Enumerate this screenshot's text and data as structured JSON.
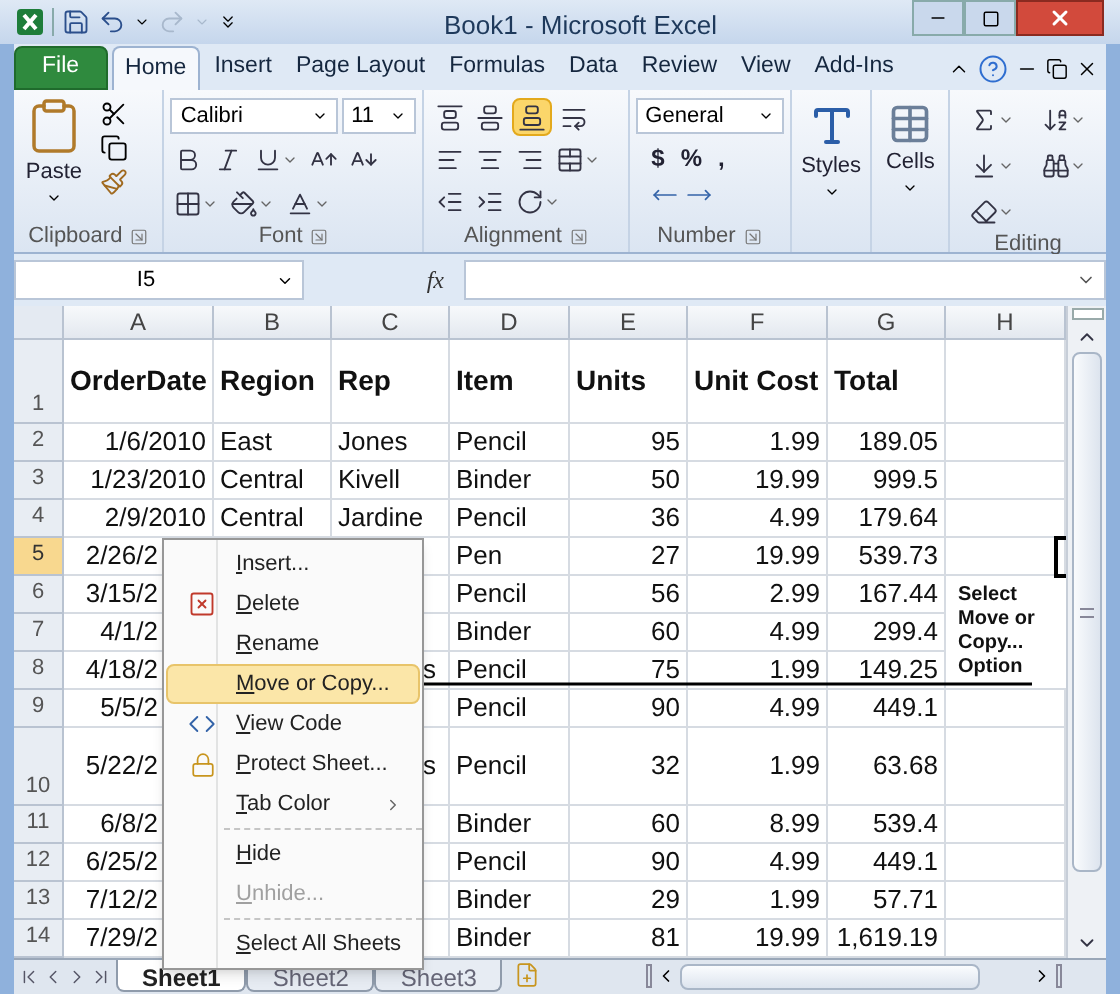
{
  "title_bar": {
    "title": "Book1  -  Microsoft Excel"
  },
  "ribbon_tabs": [
    {
      "label": "File",
      "kind": "file",
      "selected": false
    },
    {
      "label": "Home",
      "kind": "tab",
      "selected": true
    },
    {
      "label": "Insert",
      "kind": "tab",
      "selected": false
    },
    {
      "label": "Page Layout",
      "kind": "tab",
      "selected": false
    },
    {
      "label": "Formulas",
      "kind": "tab",
      "selected": false
    },
    {
      "label": "Data",
      "kind": "tab",
      "selected": false
    },
    {
      "label": "Review",
      "kind": "tab",
      "selected": false
    },
    {
      "label": "View",
      "kind": "tab",
      "selected": false
    },
    {
      "label": "Add-Ins",
      "kind": "tab",
      "selected": false
    }
  ],
  "ribbon": {
    "clipboard": {
      "label": "Clipboard",
      "paste": "Paste"
    },
    "font": {
      "label": "Font",
      "name": "Calibri",
      "size": "11"
    },
    "alignment": {
      "label": "Alignment",
      "vertical": [
        {
          "selected": false
        },
        {
          "selected": false
        },
        {
          "selected": true
        }
      ]
    },
    "number": {
      "label": "Number",
      "format": "General",
      "symbols": [
        "$",
        "%",
        ","
      ]
    },
    "styles": {
      "label": "Styles"
    },
    "cells": {
      "label": "Cells"
    },
    "editing": {
      "label": "Editing"
    }
  },
  "formula_bar": {
    "name_box": "I5",
    "fx": "fx"
  },
  "sheet": {
    "columns": [
      "A",
      "B",
      "C",
      "D",
      "E",
      "F",
      "G",
      "H"
    ],
    "rows": [
      {
        "header": "1",
        "kind": "header",
        "selected": false,
        "cells": [
          "OrderDate",
          "Region",
          "Rep",
          "Item",
          "Units",
          "Unit Cost",
          "Total"
        ]
      },
      {
        "header": "2",
        "kind": "data",
        "selected": false,
        "cells": [
          "1/6/2010",
          "East",
          "Jones",
          "Pencil",
          "95",
          "1.99",
          "189.05"
        ]
      },
      {
        "header": "3",
        "kind": "data",
        "selected": false,
        "cells": [
          "1/23/2010",
          "Central",
          "Kivell",
          "Binder",
          "50",
          "19.99",
          "999.5"
        ]
      },
      {
        "header": "4",
        "kind": "data",
        "selected": false,
        "cells": [
          "2/9/2010",
          "Central",
          "Jardine",
          "Pencil",
          "36",
          "4.99",
          "179.64"
        ]
      },
      {
        "header": "5",
        "kind": "covered",
        "selected": true,
        "cells": [
          "2/26/2",
          null,
          null,
          "Pen",
          "27",
          "19.99",
          "539.73"
        ]
      },
      {
        "header": "6",
        "kind": "covered",
        "selected": false,
        "cells": [
          "3/15/2",
          null,
          null,
          "Pencil",
          "56",
          "2.99",
          "167.44"
        ]
      },
      {
        "header": "7",
        "kind": "covered",
        "selected": false,
        "cells": [
          "4/1/2",
          null,
          null,
          "Binder",
          "60",
          "4.99",
          "299.4"
        ]
      },
      {
        "header": "8",
        "kind": "covered",
        "selected": false,
        "cells": [
          "4/18/2",
          null,
          "s",
          "Pencil",
          "75",
          "1.99",
          "149.25"
        ]
      },
      {
        "header": "9",
        "kind": "covered",
        "selected": false,
        "cells": [
          "5/5/2",
          null,
          null,
          "Pencil",
          "90",
          "4.99",
          "449.1"
        ]
      },
      {
        "header": "10",
        "kind": "covered_tall",
        "selected": false,
        "cells": [
          "5/22/2",
          null,
          "s",
          "Pencil",
          "32",
          "1.99",
          "63.68"
        ]
      },
      {
        "header": "11",
        "kind": "covered",
        "selected": false,
        "cells": [
          "6/8/2",
          null,
          null,
          "Binder",
          "60",
          "8.99",
          "539.4"
        ]
      },
      {
        "header": "12",
        "kind": "covered",
        "selected": false,
        "cells": [
          "6/25/2",
          null,
          null,
          "Pencil",
          "90",
          "4.99",
          "449.1"
        ]
      },
      {
        "header": "13",
        "kind": "covered",
        "selected": false,
        "cells": [
          "7/12/2",
          null,
          null,
          "Binder",
          "29",
          "1.99",
          "57.71"
        ]
      },
      {
        "header": "14",
        "kind": "covered",
        "selected": false,
        "cells": [
          "7/29/2",
          null,
          null,
          "Binder",
          "81",
          "19.99",
          "1,619.19"
        ]
      }
    ]
  },
  "context_menu": {
    "items": [
      {
        "kind": "plain",
        "label": "Insert...",
        "selected": false,
        "disabled": false
      },
      {
        "kind": "delete",
        "label": "Delete",
        "selected": false,
        "disabled": false
      },
      {
        "kind": "plain",
        "label": "Rename",
        "selected": false,
        "disabled": false
      },
      {
        "kind": "plain",
        "label": "Move or Copy...",
        "selected": true,
        "disabled": false
      },
      {
        "kind": "code",
        "label": "View Code",
        "selected": false,
        "disabled": false
      },
      {
        "kind": "protect",
        "label": "Protect Sheet...",
        "selected": false,
        "disabled": false
      },
      {
        "kind": "submenu",
        "label": "Tab Color",
        "selected": false,
        "disabled": false
      },
      {
        "kind": "separator"
      },
      {
        "kind": "plain",
        "label": "Hide",
        "selected": false,
        "disabled": false
      },
      {
        "kind": "plain",
        "label": "Unhide...",
        "selected": false,
        "disabled": true
      },
      {
        "kind": "separator"
      },
      {
        "kind": "plain",
        "label": "Select All Sheets",
        "selected": false,
        "disabled": false
      }
    ]
  },
  "annotation": {
    "text": "Select Move or Copy... Option"
  },
  "sheet_tabs": [
    {
      "label": "Sheet1",
      "selected": true
    },
    {
      "label": "Sheet2",
      "selected": false
    },
    {
      "label": "Sheet3",
      "selected": false
    }
  ]
}
